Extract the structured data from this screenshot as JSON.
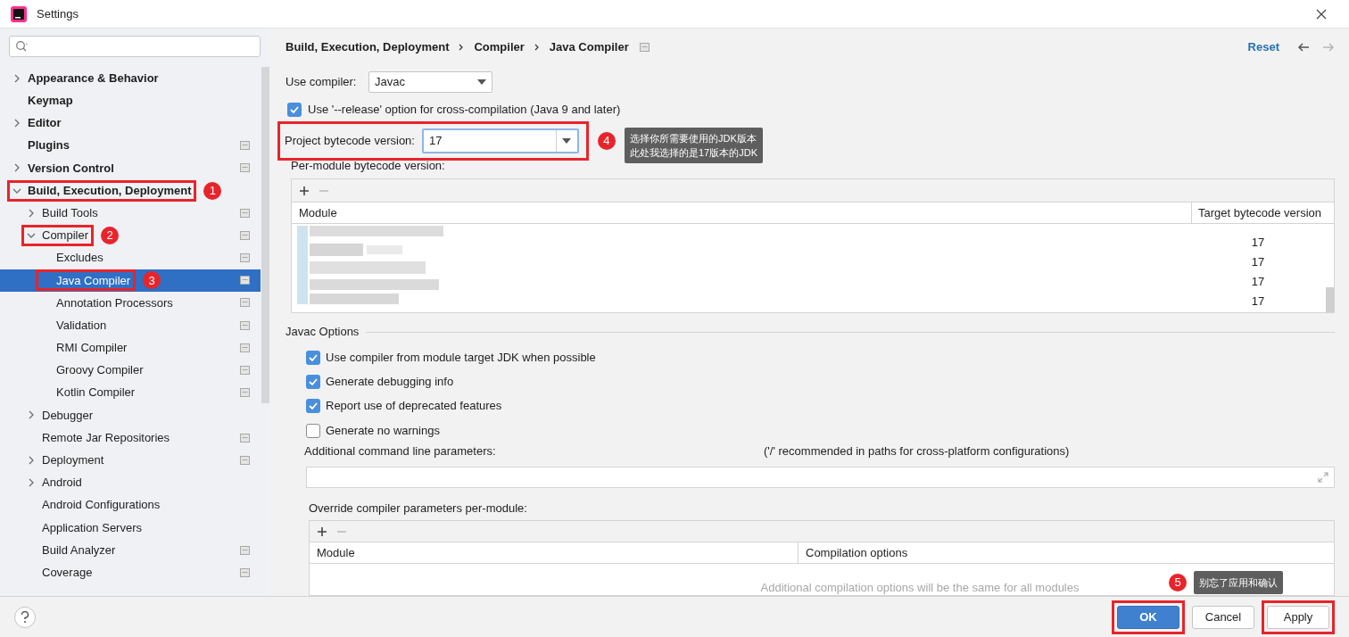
{
  "window": {
    "title": "Settings"
  },
  "sidebar": {
    "items": [
      {
        "label": "Appearance & Behavior",
        "expanded": false,
        "selected": false
      },
      {
        "label": "Keymap",
        "selected": false
      },
      {
        "label": "Editor",
        "expanded": false,
        "selected": false
      },
      {
        "label": "Plugins",
        "project_level": true,
        "selected": false
      },
      {
        "label": "Version Control",
        "expanded": false,
        "project_level": true,
        "selected": false
      },
      {
        "label": "Build, Execution, Deployment",
        "expanded": true,
        "highlighted": true,
        "badge": "1",
        "selected": false,
        "children": [
          {
            "label": "Build Tools",
            "expanded": false,
            "project_level": true,
            "selected": false
          },
          {
            "label": "Compiler",
            "expanded": true,
            "highlighted": true,
            "badge": "2",
            "project_level": true,
            "selected": false,
            "children": [
              {
                "label": "Excludes",
                "project_level": true,
                "selected": false
              },
              {
                "label": "Java Compiler",
                "selected": true,
                "highlighted": true,
                "badge": "3",
                "project_level": true
              },
              {
                "label": "Annotation Processors",
                "project_level": true,
                "selected": false
              },
              {
                "label": "Validation",
                "project_level": true,
                "selected": false
              },
              {
                "label": "RMI Compiler",
                "project_level": true,
                "selected": false
              },
              {
                "label": "Groovy Compiler",
                "project_level": true,
                "selected": false
              },
              {
                "label": "Kotlin Compiler",
                "project_level": true,
                "selected": false
              }
            ]
          },
          {
            "label": "Debugger",
            "expanded": false,
            "selected": false
          },
          {
            "label": "Remote Jar Repositories",
            "project_level": true,
            "selected": false
          },
          {
            "label": "Deployment",
            "expanded": false,
            "project_level": true,
            "selected": false
          },
          {
            "label": "Android",
            "expanded": false,
            "selected": false
          },
          {
            "label": "Android Configurations",
            "selected": false
          },
          {
            "label": "Application Servers",
            "selected": false
          },
          {
            "label": "Build Analyzer",
            "project_level": true,
            "selected": false
          },
          {
            "label": "Coverage",
            "project_level": true,
            "selected": false
          }
        ]
      }
    ]
  },
  "breadcrumb": [
    "Build, Execution, Deployment",
    "Compiler",
    "Java Compiler"
  ],
  "reset": "Reset",
  "use_compiler": {
    "label": "Use compiler:",
    "value": "Javac"
  },
  "release_option": {
    "label": "Use '--release' option for cross-compilation (Java 9 and later)",
    "checked": true
  },
  "project_bytecode": {
    "label": "Project bytecode version:",
    "value": "17",
    "highlighted": true,
    "badge": "4",
    "note": [
      "选择你所需要使用的JDK版本",
      "此处我选择的是17版本的JDK"
    ]
  },
  "per_module": {
    "label": "Per-module bytecode version:",
    "columns": [
      "Module",
      "Target bytecode version"
    ],
    "rows": [
      {
        "target": "17"
      },
      {
        "target": "17"
      },
      {
        "target": "17"
      },
      {
        "target": "17"
      }
    ]
  },
  "javac_options": {
    "title": "Javac Options",
    "options": [
      {
        "label": "Use compiler from module target JDK when possible",
        "checked": true
      },
      {
        "label": "Generate debugging info",
        "checked": true
      },
      {
        "label": "Report use of deprecated features",
        "checked": true
      },
      {
        "label": "Generate no warnings",
        "checked": false
      }
    ],
    "additional_params": {
      "label": "Additional command line parameters:",
      "hint": "('/' recommended in paths for cross-platform configurations)"
    },
    "override": {
      "label": "Override compiler parameters per-module:",
      "columns": [
        "Module",
        "Compilation options"
      ],
      "empty_text": "Additional compilation options will be the same for all modules"
    }
  },
  "footer": {
    "badge": "5",
    "note": "别忘了应用和确认",
    "buttons": [
      {
        "label": "OK",
        "primary": true,
        "highlighted": true
      },
      {
        "label": "Cancel",
        "primary": false,
        "highlighted": false
      },
      {
        "label": "Apply",
        "primary": false,
        "highlighted": true
      }
    ]
  }
}
